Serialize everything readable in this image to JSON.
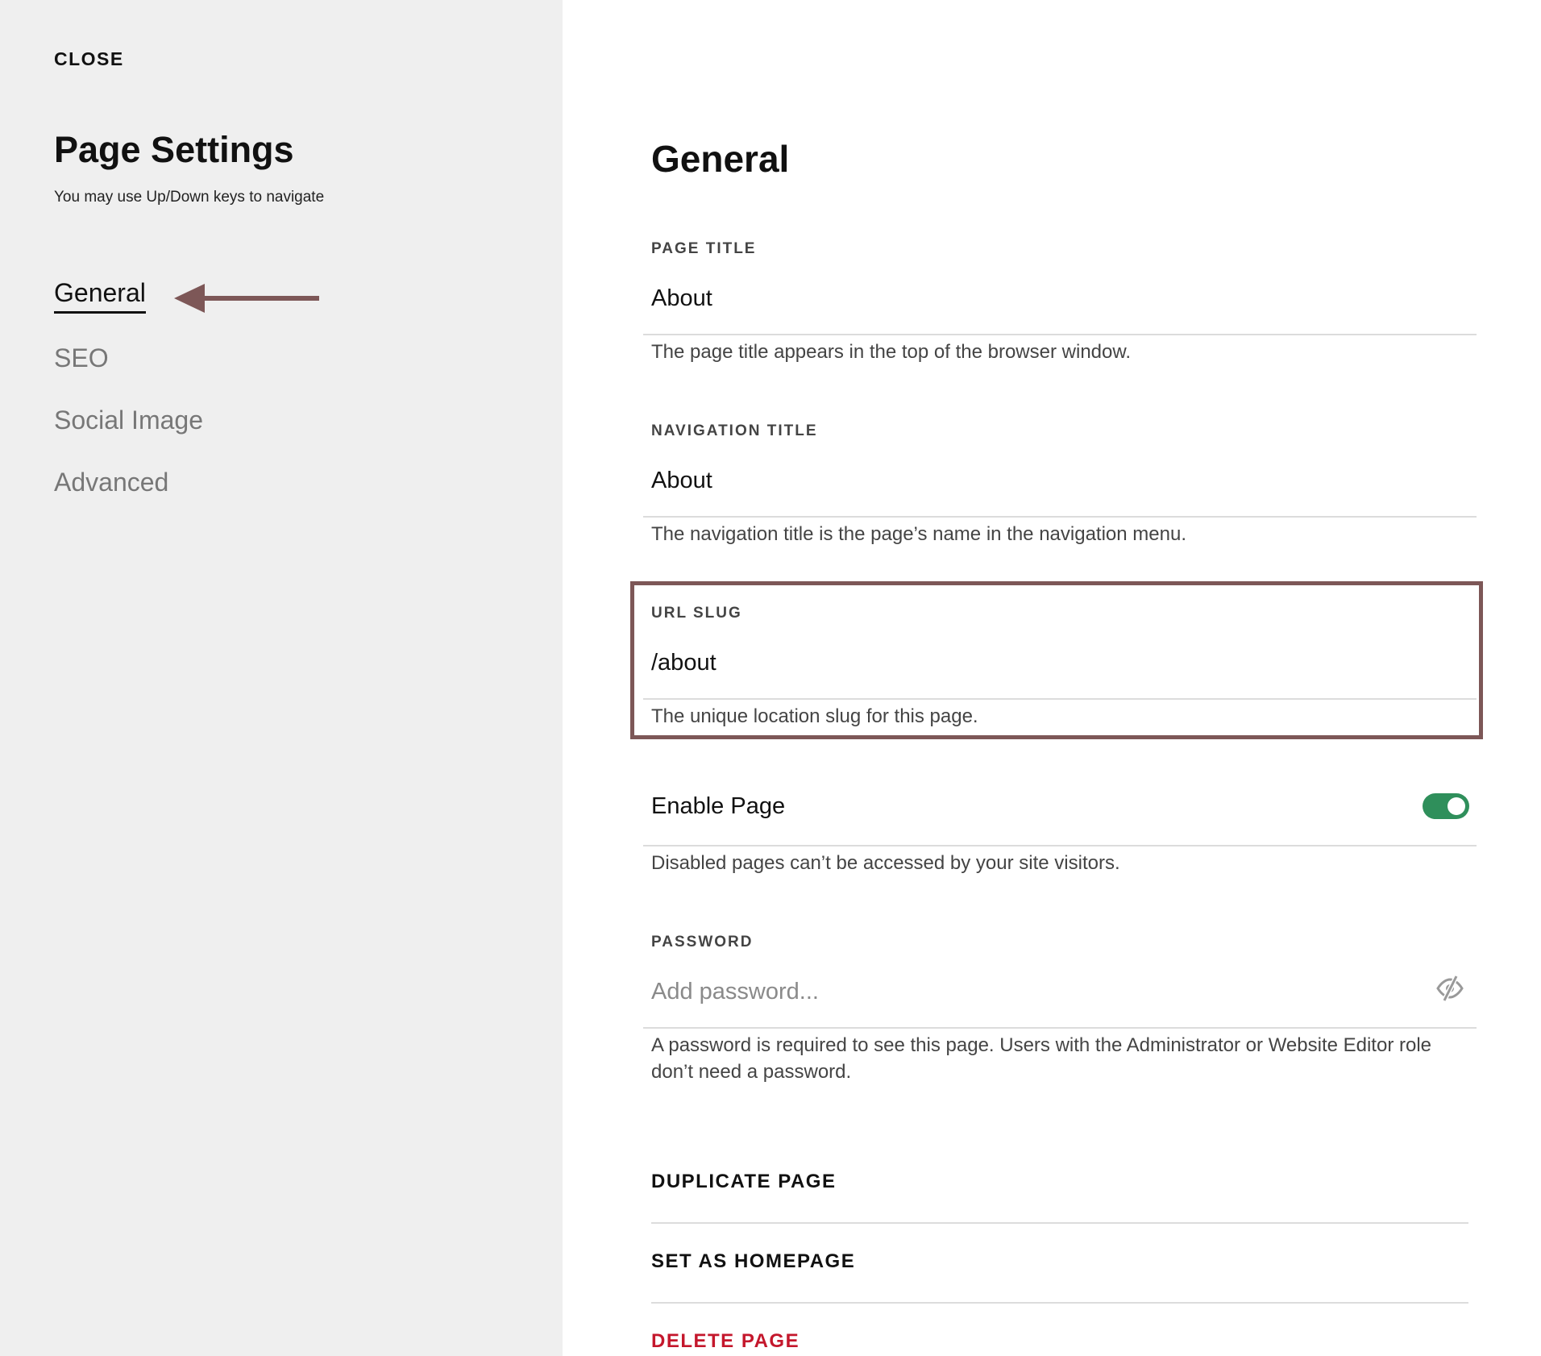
{
  "sidebar": {
    "close_label": "CLOSE",
    "title": "Page Settings",
    "hint": "You may use Up/Down keys to navigate",
    "nav": [
      {
        "label": "General",
        "active": true
      },
      {
        "label": "SEO",
        "active": false
      },
      {
        "label": "Social Image",
        "active": false
      },
      {
        "label": "Advanced",
        "active": false
      }
    ]
  },
  "annotation": {
    "color": "#7d5757",
    "arrow_icon": "left-arrow-icon",
    "highlight_target": "url-slug-section"
  },
  "main": {
    "title": "General",
    "page_title": {
      "label": "PAGE TITLE",
      "value": "About",
      "help": "The page title appears in the top of the browser window."
    },
    "navigation_title": {
      "label": "NAVIGATION TITLE",
      "value": "About",
      "help": "The navigation title is the page’s name in the navigation menu."
    },
    "url_slug": {
      "label": "URL SLUG",
      "value": "/about",
      "help": "The unique location slug for this page."
    },
    "enable_page": {
      "label": "Enable Page",
      "enabled": true,
      "toggle_color": "#2f8f5b",
      "help": "Disabled pages can’t be accessed by your site visitors."
    },
    "password": {
      "label": "PASSWORD",
      "value": "",
      "placeholder": "Add password...",
      "icon": "eye-off-icon",
      "help": "A password is required to see this page. Users with the Administrator or Website Editor role don’t need a password."
    },
    "actions": {
      "duplicate": "DUPLICATE PAGE",
      "set_homepage": "SET AS HOMEPAGE",
      "delete": "DELETE PAGE",
      "delete_color": "#c4172c"
    }
  }
}
